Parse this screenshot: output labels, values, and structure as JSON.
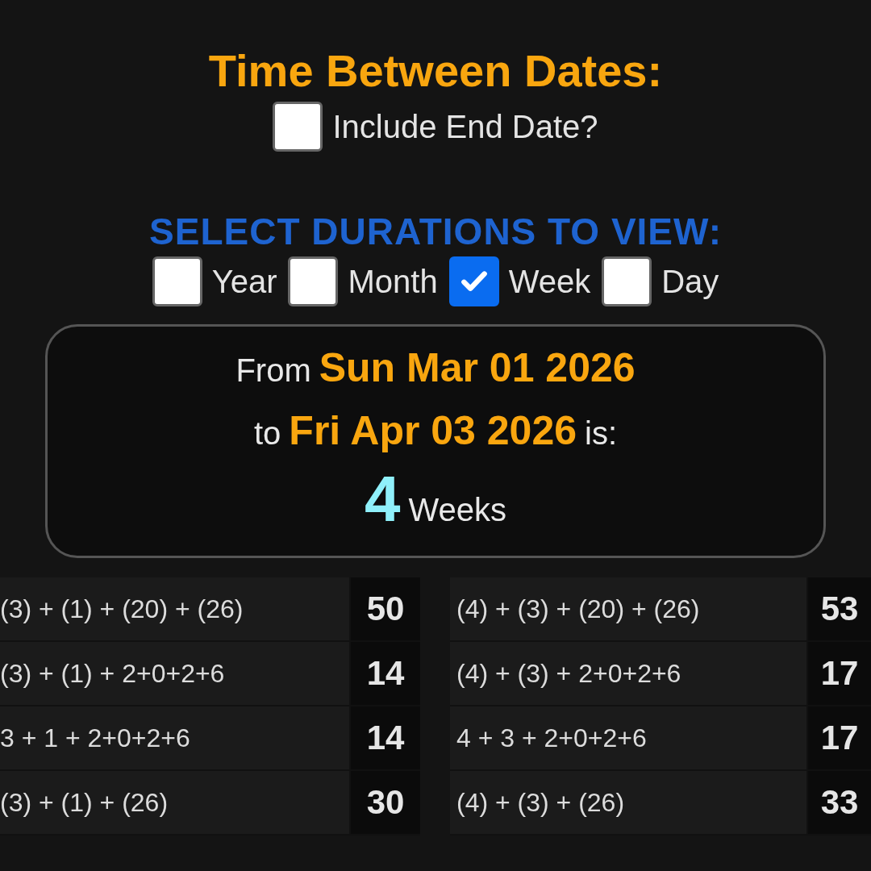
{
  "title": "Time Between Dates:",
  "include_end_date": {
    "label": "Include End Date?",
    "checked": false
  },
  "durations_heading": "SELECT DURATIONS TO VIEW:",
  "durations": [
    {
      "label": "Year",
      "checked": false
    },
    {
      "label": "Month",
      "checked": false
    },
    {
      "label": "Week",
      "checked": true
    },
    {
      "label": "Day",
      "checked": false
    }
  ],
  "result": {
    "from_prefix": "From",
    "from_date": "Sun Mar 01 2026",
    "to_prefix": "to",
    "to_date": "Fri Apr 03 2026",
    "suffix": "is:",
    "amount": "4",
    "unit": "Weeks"
  },
  "tables": [
    {
      "rows": [
        {
          "expression": "(3) + (1) + (20) + (26)",
          "total": "50"
        },
        {
          "expression": "(3) + (1) + 2+0+2+6",
          "total": "14"
        },
        {
          "expression": "3 + 1 + 2+0+2+6",
          "total": "14"
        },
        {
          "expression": "(3) + (1) + (26)",
          "total": "30"
        }
      ]
    },
    {
      "rows": [
        {
          "expression": "(4) + (3) + (20) + (26)",
          "total": "53"
        },
        {
          "expression": "(4) + (3) + 2+0+2+6",
          "total": "17"
        },
        {
          "expression": "4 + 3 + 2+0+2+6",
          "total": "17"
        },
        {
          "expression": "(4) + (3) + (26)",
          "total": "33"
        }
      ]
    }
  ]
}
